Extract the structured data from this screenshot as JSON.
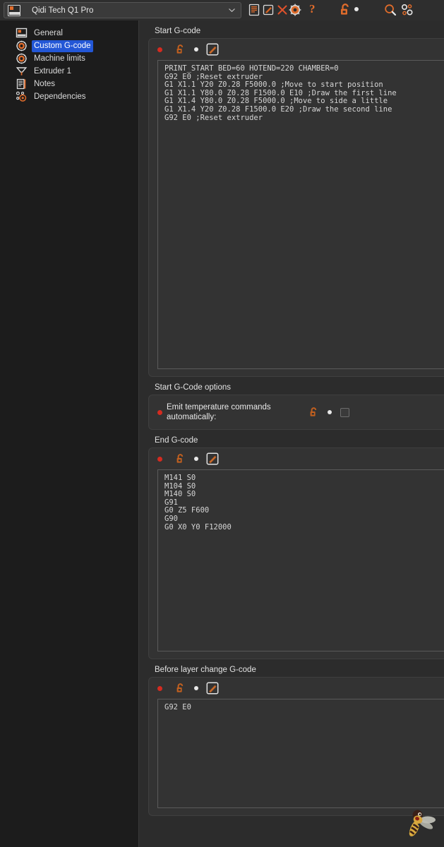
{
  "window": {
    "title": "Qidi Tech Q1 Pro"
  },
  "toolbar": {
    "preset_value": "Qidi Tech Q1 Pro",
    "preset_icon": "printer-preset-icon",
    "dropdown_icon": "chevron-down-icon",
    "actions": [
      {
        "name": "save-preset-icon",
        "label": "Save"
      },
      {
        "name": "rename-preset-icon",
        "label": "Rename"
      },
      {
        "name": "delete-preset-icon",
        "label": "Delete"
      },
      {
        "name": "printer-settings-icon",
        "label": "Printer settings"
      }
    ],
    "help_label": "?",
    "lock_icon": "unlocked-padlock-icon",
    "modified_dot": "white-dot-icon",
    "search_icon": "search-icon",
    "compare_icon": "compare-presets-icon"
  },
  "sidebar": {
    "items": [
      {
        "label": "General",
        "icon": "printer-general-icon",
        "selected": false
      },
      {
        "label": "Custom G-code",
        "icon": "gear-icon",
        "selected": true
      },
      {
        "label": "Machine limits",
        "icon": "gear-icon",
        "selected": false
      },
      {
        "label": "Extruder 1",
        "icon": "extruder-nozzle-icon",
        "selected": false
      },
      {
        "label": "Notes",
        "icon": "notes-icon",
        "selected": false
      },
      {
        "label": "Dependencies",
        "icon": "dependencies-icon",
        "selected": false
      }
    ]
  },
  "sections": {
    "start_gcode": {
      "title": "Start G-code",
      "code": "PRINT_START BED=60 HOTEND=220 CHAMBER=0\nG92 E0 ;Reset extruder\nG1 X1.1 Y20 Z0.28 F5000.0 ;Move to start position\nG1 X1.1 Y80.0 Z0.28 F1500.0 E10 ;Draw the first line\nG1 X1.4 Y80.0 Z0.28 F5000.0 ;Move to side a little\nG1 X1.4 Y20 Z0.28 F1500.0 E20 ;Draw the second line\nG92 E0 ;Reset extruder"
    },
    "start_gcode_options": {
      "title": "Start G-Code options",
      "option_label": "Emit temperature commands automatically:",
      "checked": false
    },
    "end_gcode": {
      "title": "End G-code",
      "code": "M141 S0\nM104 S0\nM140 S0\nG91\nG0 Z5 F600\nG90\nG0 X0 Y0 F12000"
    },
    "before_layer_change_gcode": {
      "title": "Before layer change G-code",
      "code": "G92 E0"
    }
  },
  "colors": {
    "accent_orange": "#e06c2b",
    "selection_blue": "#2357d6",
    "modified_red": "#d42b20",
    "panel_bg": "#333333",
    "window_bg": "#2c2c2c",
    "sidebar_bg": "#1c1c1c"
  },
  "watermark": {
    "icon": "bee-mascot-icon"
  }
}
